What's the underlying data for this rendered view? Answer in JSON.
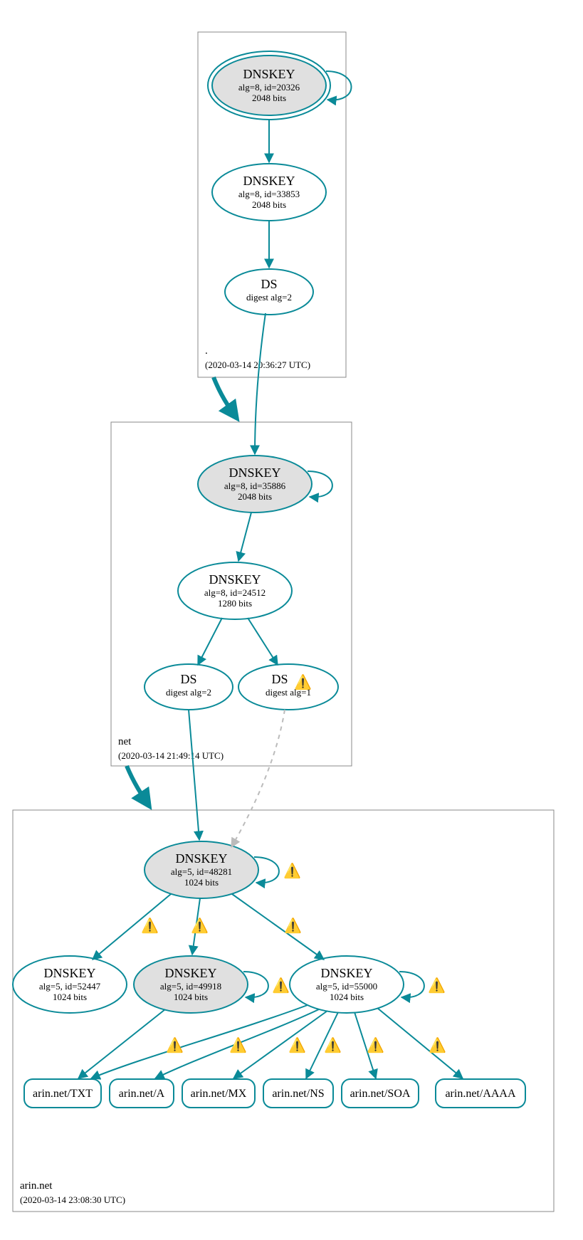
{
  "zones": {
    "root": {
      "label": ".",
      "timestamp": "(2020-03-14 20:36:27 UTC)"
    },
    "net": {
      "label": "net",
      "timestamp": "(2020-03-14 21:49:14 UTC)"
    },
    "arin": {
      "label": "arin.net",
      "timestamp": "(2020-03-14 23:08:30 UTC)"
    }
  },
  "nodes": {
    "root_ksk": {
      "title": "DNSKEY",
      "line1": "alg=8, id=20326",
      "line2": "2048 bits"
    },
    "root_zsk": {
      "title": "DNSKEY",
      "line1": "alg=8, id=33853",
      "line2": "2048 bits"
    },
    "root_ds": {
      "title": "DS",
      "line1": "digest alg=2"
    },
    "net_ksk": {
      "title": "DNSKEY",
      "line1": "alg=8, id=35886",
      "line2": "2048 bits"
    },
    "net_zsk": {
      "title": "DNSKEY",
      "line1": "alg=8, id=24512",
      "line2": "1280 bits"
    },
    "net_ds2": {
      "title": "DS",
      "line1": "digest alg=2"
    },
    "net_ds1": {
      "title": "DS",
      "line1": "digest alg=1"
    },
    "arin_ksk": {
      "title": "DNSKEY",
      "line1": "alg=5, id=48281",
      "line2": "1024 bits"
    },
    "arin_k1": {
      "title": "DNSKEY",
      "line1": "alg=5, id=52447",
      "line2": "1024 bits"
    },
    "arin_k2": {
      "title": "DNSKEY",
      "line1": "alg=5, id=49918",
      "line2": "1024 bits"
    },
    "arin_k3": {
      "title": "DNSKEY",
      "line1": "alg=5, id=55000",
      "line2": "1024 bits"
    }
  },
  "rrsets": {
    "txt": "arin.net/TXT",
    "a": "arin.net/A",
    "mx": "arin.net/MX",
    "ns": "arin.net/NS",
    "soa": "arin.net/SOA",
    "aaaa": "arin.net/AAAA"
  },
  "icons": {
    "warn": "⚠️"
  }
}
